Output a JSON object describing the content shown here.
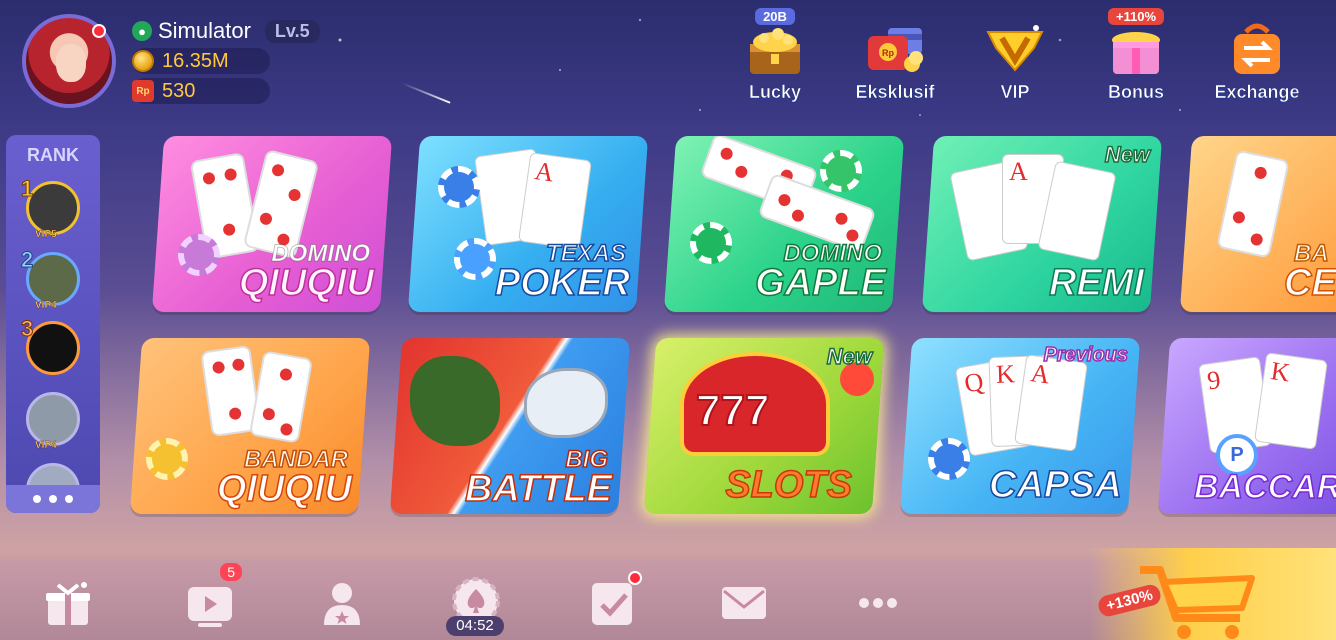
{
  "player": {
    "name": "Simulator",
    "level": "Lv.5",
    "coins": "16.35M",
    "rp_label": "Rp",
    "rp_balance": "530"
  },
  "top_menu": [
    {
      "label": "Lucky",
      "badge": "20B"
    },
    {
      "label": "Eksklusif",
      "badge": ""
    },
    {
      "label": "VIP",
      "badge": ""
    },
    {
      "label": "Bonus",
      "badge": "+110%"
    },
    {
      "label": "Exchange",
      "badge": ""
    }
  ],
  "rank": {
    "title": "RANK",
    "entries": [
      {
        "position": "1",
        "vip": "VIP5"
      },
      {
        "position": "2",
        "vip": "VIP4"
      },
      {
        "position": "3",
        "vip": ""
      },
      {
        "position": "",
        "vip": "VIP4"
      }
    ]
  },
  "games": [
    {
      "line1": "DOMINO",
      "line2": "QIUQIU",
      "tag": ""
    },
    {
      "line1": "TEXAS",
      "line2": "POKER",
      "tag": ""
    },
    {
      "line1": "DOMINO",
      "line2": "GAPLE",
      "tag": ""
    },
    {
      "line1": "",
      "line2": "REMI",
      "tag": "New"
    },
    {
      "line1": "BA",
      "line2": "CE",
      "tag": ""
    },
    {
      "line1": "BANDAR",
      "line2": "QIUQIU",
      "tag": ""
    },
    {
      "line1": "BIG",
      "line2": "BATTLE",
      "tag": ""
    },
    {
      "line1": "",
      "line2": "SLOTS",
      "tag": "New"
    },
    {
      "line1": "",
      "line2": "CAPSA",
      "tag": "Previous"
    },
    {
      "line1": "",
      "line2": "BACCARA",
      "tag": ""
    }
  ],
  "card_text": {
    "texas_ace": "A",
    "remi_ace": "A",
    "capsa_q": "Q",
    "capsa_k": "K",
    "capsa_a": "A",
    "bacc_9": "9",
    "bacc_k": "K",
    "bacc_chip": "P",
    "slots_digits": "777"
  },
  "bottom_bar": {
    "video_badge": "5",
    "timer": "04:52",
    "shop_badge": "+130%"
  },
  "colors": {
    "coin": "#ffc93a",
    "new_tag_stroke": "#1c6b3a",
    "previous_tag_stroke": "#9a2fa8",
    "badge_red": "#ff4455"
  }
}
